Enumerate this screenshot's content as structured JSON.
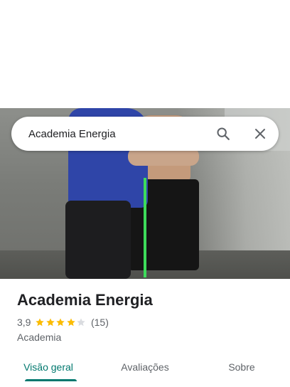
{
  "search": {
    "value": "Academia Energia",
    "icon": "search-icon",
    "close_icon": "close-icon"
  },
  "place": {
    "name": "Academia Energia",
    "rating": "3,9",
    "rating_value": 3.9,
    "stars_out_of": 5,
    "reviews": "(15)",
    "category": "Academia"
  },
  "tabs": [
    {
      "label": "Visão geral",
      "active": true
    },
    {
      "label": "Avaliações",
      "active": false
    },
    {
      "label": "Sobre",
      "active": false
    }
  ],
  "colors": {
    "accent": "#00786e",
    "star_filled": "#fbbc04",
    "star_empty": "#dadce0",
    "text_secondary": "#5f6368"
  }
}
